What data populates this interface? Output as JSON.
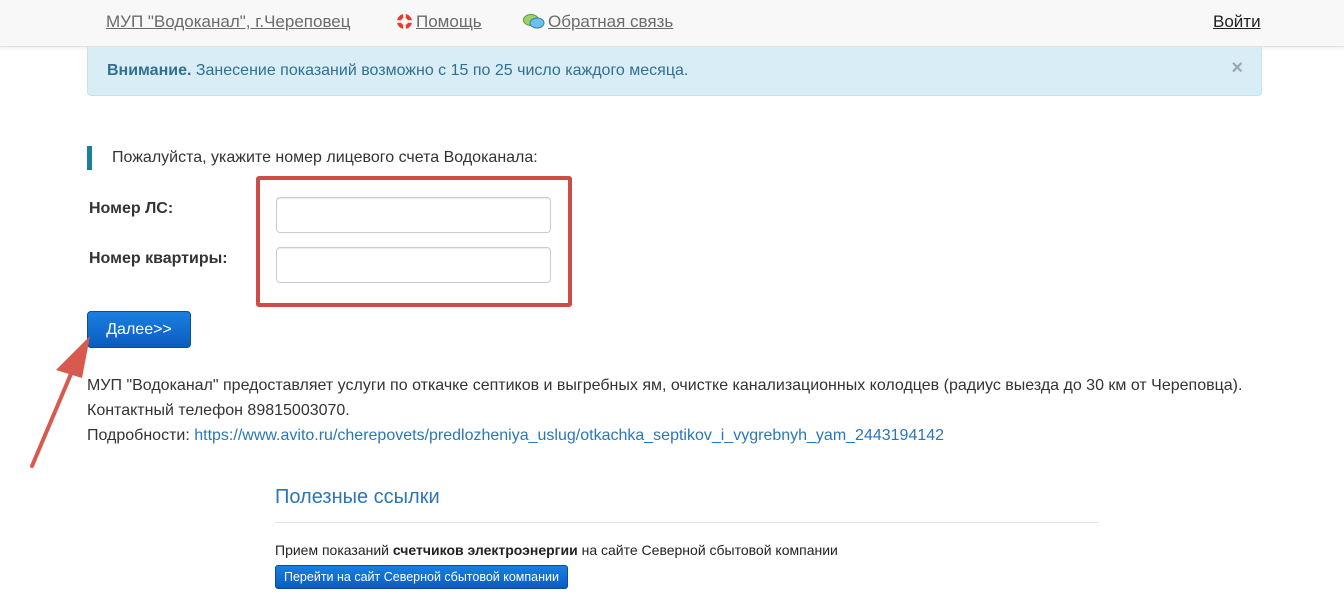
{
  "nav": {
    "org_link": "МУП \"Водоканал\", г.Череповец",
    "help_link": "Помощь",
    "feedback_link": "Обратная связь",
    "login_link": "Войти"
  },
  "alert": {
    "strong": "Внимание.",
    "text": " Занесение показаний возможно с 15 по 25 число каждого месяца.",
    "close": "×"
  },
  "form": {
    "prompt": "Пожалуйста, укажите номер лицевого счета Водоканала:",
    "account_label": "Номер ЛС:",
    "account_value": "",
    "apartment_label": "Номер квартиры:",
    "apartment_value": "",
    "next_button": "Далее>>"
  },
  "info": {
    "line1": "МУП \"Водоканал\" предоставляет услуги по откачке септиков и выгребных ям, очистке канализационных колодцев (радиус выезда до 30 км от Череповца). Контактный телефон 89815003070.",
    "details_label": "Подробности: ",
    "details_link": "https://www.avito.ru/cherepovets/predlozheniya_uslug/otkachka_septikov_i_vygrebnyh_yam_2443194142"
  },
  "useful_links": {
    "title": "Полезные ссылки",
    "text_before": "Прием показаний ",
    "text_bold": "счетчиков электроэнергии",
    "text_after": " на сайте Северной сбытовой компании",
    "button": "Перейти на сайт Северной сбытовой компании"
  },
  "colors": {
    "alert_bg": "#d9edf7",
    "alert_text": "#31708f",
    "link_blue": "#2a77b8",
    "button_blue": "#0a5dbf",
    "highlight_red": "#cf4b45",
    "callout_bar": "#1b809e"
  },
  "icons": {
    "help": "lifebuoy-icon",
    "feedback": "chat-bubbles-icon"
  }
}
